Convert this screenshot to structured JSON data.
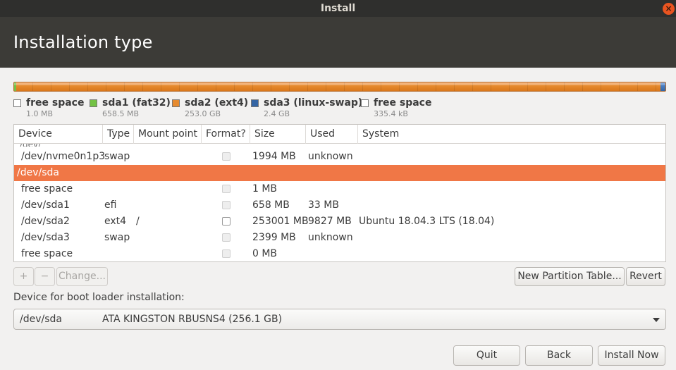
{
  "window": {
    "title": "Install"
  },
  "header": {
    "title": "Installation type"
  },
  "colors": {
    "accent": "#e95420",
    "selection": "#f07746",
    "ext4": "#e68a2e",
    "fat32": "#73c244",
    "swap": "#3465a4"
  },
  "legend": [
    {
      "name": "free space",
      "size": "1.0 MB",
      "color": "#ffffff"
    },
    {
      "name": "sda1 (fat32)",
      "size": "658.5 MB",
      "color": "#73c244"
    },
    {
      "name": "sda2 (ext4)",
      "size": "253.0 GB",
      "color": "#e68a2e"
    },
    {
      "name": "sda3 (linux-swap)",
      "size": "2.4 GB",
      "color": "#3465a4"
    },
    {
      "name": "free space",
      "size": "335.4 kB",
      "color": "#ffffff"
    }
  ],
  "table": {
    "columns": [
      "Device",
      "Type",
      "Mount point",
      "Format?",
      "Size",
      "Used",
      "System"
    ],
    "rows": [
      {
        "device": "/dev/nvme0n1p3",
        "type": "swap",
        "mount": "",
        "format_enabled": false,
        "size": "1994 MB",
        "used": "unknown",
        "system": ""
      },
      {
        "device": "/dev/sda",
        "type": "",
        "mount": "",
        "format_enabled": false,
        "size": "",
        "used": "",
        "system": "",
        "is_disk": true,
        "selected": true
      },
      {
        "device": "free space",
        "type": "",
        "mount": "",
        "format_enabled": false,
        "size": "1 MB",
        "used": "",
        "system": ""
      },
      {
        "device": "/dev/sda1",
        "type": "efi",
        "mount": "",
        "format_enabled": false,
        "size": "658 MB",
        "used": "33 MB",
        "system": ""
      },
      {
        "device": "/dev/sda2",
        "type": "ext4",
        "mount": "/",
        "format_enabled": true,
        "size": "253001 MB",
        "used": "9827 MB",
        "system": "Ubuntu 18.04.3 LTS (18.04)"
      },
      {
        "device": "/dev/sda3",
        "type": "swap",
        "mount": "",
        "format_enabled": false,
        "size": "2399 MB",
        "used": "unknown",
        "system": ""
      },
      {
        "device": "free space",
        "type": "",
        "mount": "",
        "format_enabled": false,
        "size": "0 MB",
        "used": "",
        "system": ""
      }
    ]
  },
  "toolbar": {
    "add_label": "+",
    "remove_label": "−",
    "change_label": "Change...",
    "new_table_label": "New Partition Table...",
    "revert_label": "Revert"
  },
  "bootloader": {
    "label": "Device for boot loader installation:",
    "device": "/dev/sda",
    "model": "ATA KINGSTON RBUSNS4 (256.1 GB)"
  },
  "footer": {
    "quit_label": "Quit",
    "back_label": "Back",
    "install_label": "Install Now"
  }
}
